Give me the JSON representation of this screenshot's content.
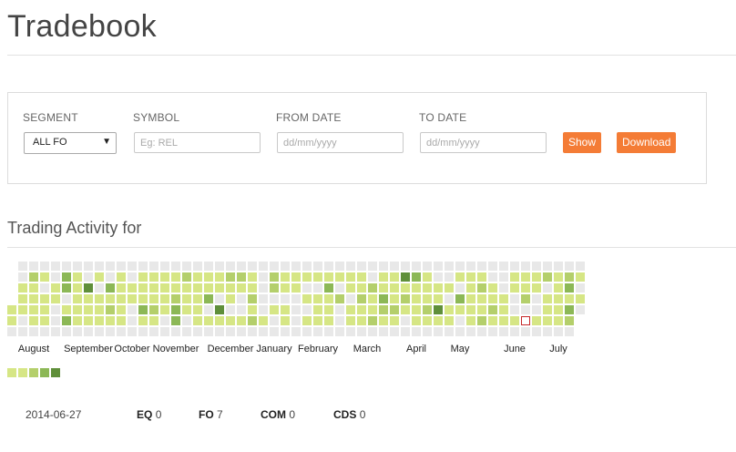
{
  "page": {
    "title": "Tradebook"
  },
  "filters": {
    "segment_label": "SEGMENT",
    "segment_value": "ALL FO",
    "symbol_label": "SYMBOL",
    "symbol_placeholder": "Eg: REL",
    "from_label": "FROM DATE",
    "from_placeholder": "dd/mm/yyyy",
    "to_label": "TO DATE",
    "to_placeholder": "dd/mm/yyyy",
    "show_label": "Show",
    "download_label": "Download"
  },
  "activity": {
    "title": "Trading Activity for",
    "months": [
      "August",
      "September",
      "October",
      "November",
      "December",
      "January",
      "February",
      "March",
      "April",
      "May",
      "June",
      "July"
    ],
    "level_colors": [
      "#e8e8e8",
      "#d6e685",
      "#b4cf6b",
      "#8cb856",
      "#5f8f3a"
    ],
    "legend_levels": [
      1,
      2,
      3,
      4,
      5
    ],
    "selected_day": "2014-06-27",
    "selected_color": "#c62828"
  },
  "summary": {
    "date": "2014-06-27",
    "eq_label": "EQ",
    "eq_value": "0",
    "fo_label": "FO",
    "fo_value": "7",
    "com_label": "COM",
    "com_value": "0",
    "cds_label": "CDS",
    "cds_value": "0"
  }
}
